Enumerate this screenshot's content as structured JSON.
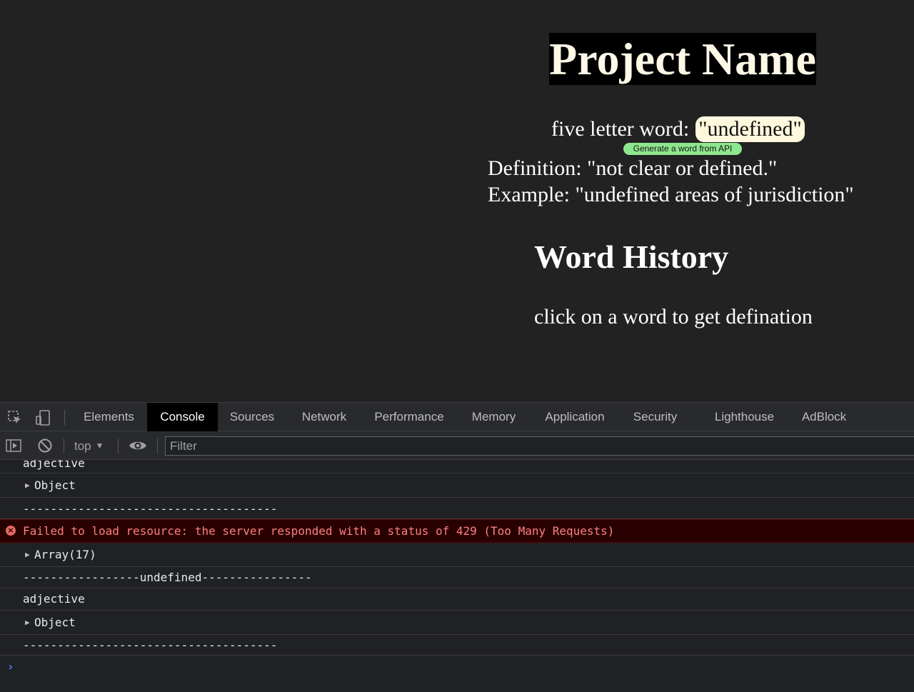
{
  "page": {
    "title": "Project Name",
    "word_label": "five letter word: ",
    "word_value": "\"undefined\"",
    "generate_button": "Generate a word from API",
    "definition": "Definition: \"not clear or defined.\"",
    "example": "Example: \"undefined areas of jurisdiction\"",
    "history_heading": "Word History",
    "history_hint": "click on a word to get defination"
  },
  "devtools": {
    "tabs": [
      {
        "label": "Elements",
        "active": false
      },
      {
        "label": "Console",
        "active": true
      },
      {
        "label": "Sources",
        "active": false
      },
      {
        "label": "Network",
        "active": false
      },
      {
        "label": "Performance",
        "active": false
      },
      {
        "label": "Memory",
        "active": false
      },
      {
        "label": "Application",
        "active": false
      },
      {
        "label": "Security",
        "active": false
      },
      {
        "label": "Lighthouse",
        "active": false
      },
      {
        "label": "AdBlock",
        "active": false
      }
    ],
    "context": "top",
    "filter_placeholder": "Filter",
    "icons": [
      "inspect-icon",
      "device-toggle-icon",
      "sidebar-toggle-icon",
      "clear-console-icon",
      "eye-icon",
      "error-icon",
      "prompt-chevron-icon"
    ],
    "console_rows": [
      {
        "text": "adjective",
        "type": "log"
      },
      {
        "text": "Object",
        "type": "object"
      },
      {
        "text": "-------------------------------------",
        "type": "log"
      },
      {
        "text": "Failed to load resource: the server responded with a status of 429 (Too Many Requests)",
        "type": "error"
      },
      {
        "text": "Array(17)",
        "type": "object"
      },
      {
        "text": "-----------------undefined----------------",
        "type": "log"
      },
      {
        "text": "adjective",
        "type": "log"
      },
      {
        "text": "Object",
        "type": "object"
      },
      {
        "text": "-------------------------------------",
        "type": "log"
      }
    ],
    "colors": {
      "error_bg": "#290000",
      "error_text": "#ff8080",
      "active_tab_bg": "#000000",
      "prompt": "#4b8ef7"
    }
  }
}
